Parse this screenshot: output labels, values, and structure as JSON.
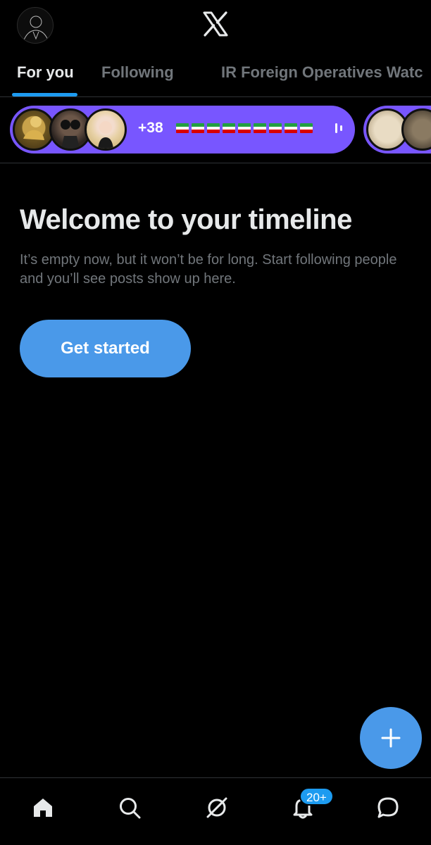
{
  "header": {
    "logo_icon": "x-logo-icon",
    "avatar_icon": "profile-avatar"
  },
  "tabs": [
    {
      "label": "For you",
      "active": true
    },
    {
      "label": "Following",
      "active": false
    },
    {
      "label": "IR Foreign Operatives Watc",
      "active": false
    }
  ],
  "space": {
    "count": "+38",
    "accent": "#7856ff"
  },
  "welcome": {
    "title": "Welcome to your timeline",
    "body": "It’s empty now, but it won’t be for long. Start following people and you’ll see posts show up here.",
    "button": "Get started"
  },
  "fab": {
    "icon": "plus-icon"
  },
  "bottom_nav": {
    "items": [
      "home-icon",
      "search-icon",
      "grok-icon",
      "bell-icon",
      "messages-icon"
    ],
    "notifications_badge": "20+"
  },
  "colors": {
    "accent": "#1d9bf0",
    "button": "#4a99e9",
    "background": "#000000",
    "muted": "#71767b"
  }
}
